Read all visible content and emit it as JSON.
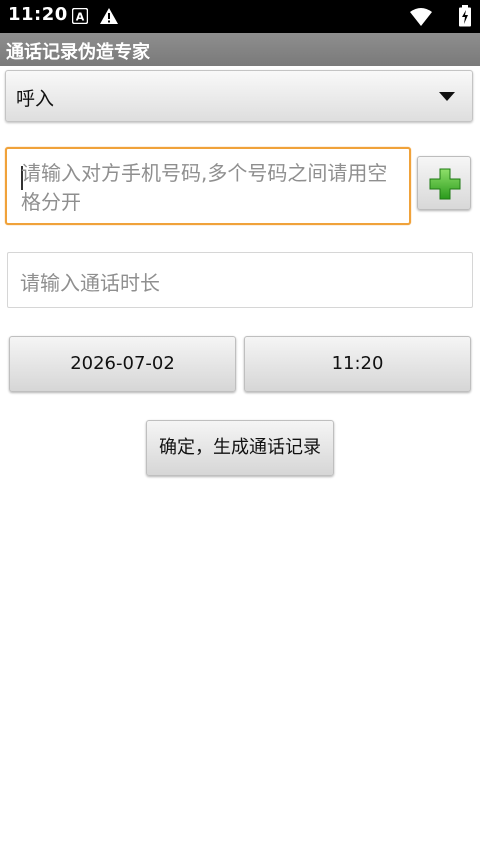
{
  "status_bar": {
    "time": "11:20",
    "icons": [
      "accessibility-icon",
      "warning-icon",
      "wifi-icon",
      "battery-icon"
    ]
  },
  "app": {
    "title": "通话记录伪造专家"
  },
  "call_type": {
    "selected": "呼入"
  },
  "phone_input": {
    "placeholder": "请输入对方手机号码,多个号码之间请用空格分开",
    "value": ""
  },
  "duration_input": {
    "placeholder": "请输入通话时长",
    "value": ""
  },
  "date_button": {
    "label": "2026-07-02"
  },
  "time_button": {
    "label": "11:20"
  },
  "confirm_button": {
    "label": "确定，生成通话记录"
  },
  "colors": {
    "title_bar": "#808080",
    "focus_border": "#f0a23a",
    "add_icon": "#3fae2a"
  }
}
